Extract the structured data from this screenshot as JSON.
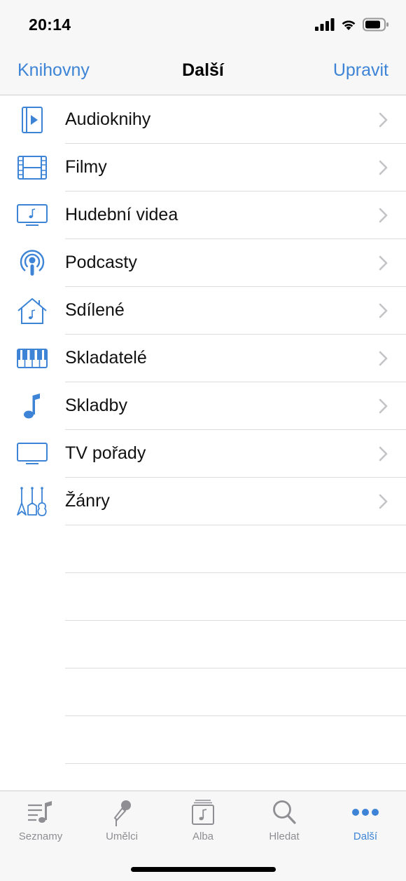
{
  "status_bar": {
    "time": "20:14"
  },
  "nav": {
    "back_label": "Knihovny",
    "title": "Další",
    "edit_label": "Upravit"
  },
  "colors": {
    "accent": "#3d84d6",
    "inactive": "#8e8e93"
  },
  "list": {
    "items": [
      {
        "label": "Audioknihy",
        "icon": "audiobook-icon"
      },
      {
        "label": "Filmy",
        "icon": "film-icon"
      },
      {
        "label": "Hudební videa",
        "icon": "music-video-icon"
      },
      {
        "label": "Podcasty",
        "icon": "podcast-icon"
      },
      {
        "label": "Sdílené",
        "icon": "home-sharing-icon"
      },
      {
        "label": "Skladatelé",
        "icon": "piano-keys-icon"
      },
      {
        "label": "Skladby",
        "icon": "music-note-icon"
      },
      {
        "label": "TV pořady",
        "icon": "tv-icon"
      },
      {
        "label": "Žánry",
        "icon": "guitars-icon"
      }
    ]
  },
  "tab_bar": {
    "tabs": [
      {
        "label": "Seznamy",
        "icon": "playlist-icon",
        "active": false
      },
      {
        "label": "Umělci",
        "icon": "microphone-icon",
        "active": false
      },
      {
        "label": "Alba",
        "icon": "album-icon",
        "active": false
      },
      {
        "label": "Hledat",
        "icon": "search-icon",
        "active": false
      },
      {
        "label": "Další",
        "icon": "more-icon",
        "active": true
      }
    ]
  }
}
